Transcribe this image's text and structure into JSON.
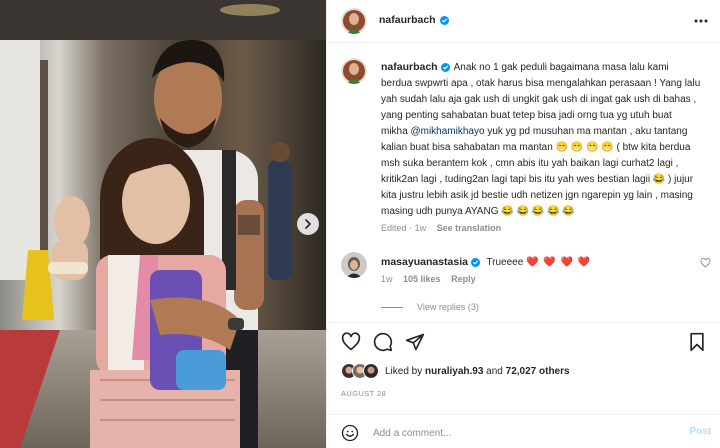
{
  "post": {
    "username": "nafaurbach",
    "verified": true,
    "more_icon": "more-horizontal-icon",
    "next_icon": "chevron-right-icon"
  },
  "caption": {
    "username": "nafaurbach",
    "text_before_mention": "Anak no 1 gak peduli bagaimana masa lalu kami berdua swpwrti apa , otak harus bisa mengalahkan perasaan ! Yang lalu yah sudah lalu aja gak ush di ungkit gak ush di ingat gak ush di bahas , yang penting sahabatan buat tetep bisa jadi orng tua yg utuh buat mikha",
    "mention": "@mikhamikhayo",
    "text_after_mention": "yuk yg pd musuhan ma mantan , aku tantang kalian buat bisa sahabatan ma mantan 😁 😁 😁 😁 ( btw kita berdua msh suka berantem kok , cmn abis itu yah baikan lagi curhat2 lagi , kritik2an lagi , tuding2an lagi tapi bis itu yah wes bestian lagii 😂 ) jujur kita justru lebih asik jd bestie udh netizen jgn ngarepin yg lain , masing masing udh punya AYANG 😂 😂 😂 😂 😂",
    "edited": "Edited",
    "time": "1w",
    "see_translation": "See translation"
  },
  "comment": {
    "username": "masayuanastasia",
    "verified": true,
    "text": "Trueeee",
    "hearts": "❤️ ❤️ ❤️ ❤️",
    "time": "1w",
    "likes": "105 likes",
    "reply": "Reply",
    "view_replies": "View replies (3)",
    "like_icon": "heart-outline-icon"
  },
  "actions": {
    "like_icon": "heart-outline-icon",
    "comment_icon": "comment-bubble-icon",
    "share_icon": "paper-plane-icon",
    "save_icon": "bookmark-icon",
    "liked_by_prefix": "Liked by",
    "liked_by_user": "nuraliyah.93",
    "and": "and",
    "others_count": "72,027 others",
    "date": "AUGUST 28"
  },
  "add_comment": {
    "emoji_icon": "smiley-icon",
    "placeholder": "Add a comment...",
    "post_label": "Post"
  },
  "colors": {
    "link": "#00376b",
    "muted": "#8e8e8e",
    "verified": "#0095f6",
    "post_disabled": "#b2dffc",
    "heart": "#ed4956"
  }
}
